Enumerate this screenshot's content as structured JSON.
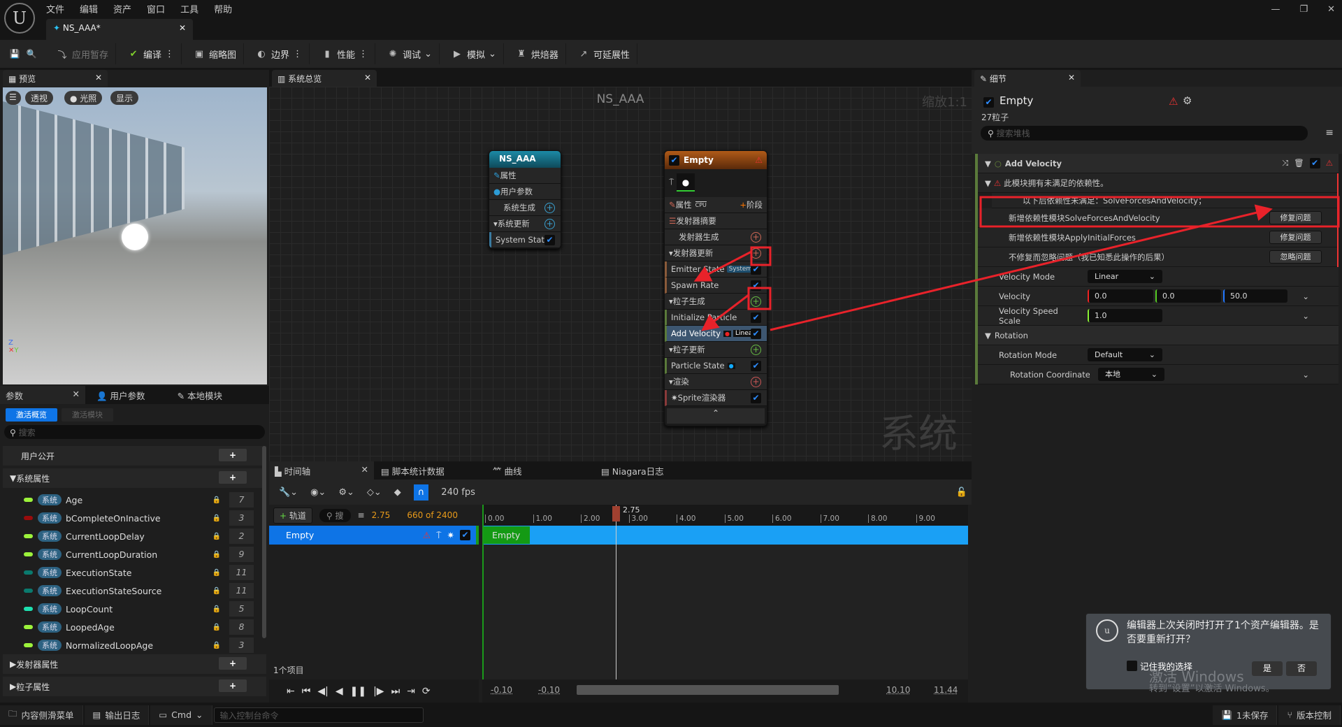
{
  "menu": [
    "文件",
    "编辑",
    "资产",
    "窗口",
    "工具",
    "帮助"
  ],
  "document_tab": "NS_AAA*",
  "toolbar": [
    "应用暂存",
    "编译",
    "缩略图",
    "边界",
    "性能",
    "调试",
    "模拟",
    "烘焙器",
    "可延展性"
  ],
  "preview": {
    "tab": "预览",
    "buttons": [
      "透视",
      "光照",
      "显示"
    ],
    "axes": [
      "Z",
      "Y"
    ]
  },
  "params": {
    "tabs": [
      "参数",
      "用户参数",
      "本地模块"
    ],
    "filter_tabs": [
      "激活概览",
      "激活模块"
    ],
    "search_placeholder": "搜索",
    "sections": {
      "user": "用户公开",
      "system": "系统属性",
      "emitter": "发射器属性",
      "particle": "粒子属性"
    },
    "badge": "系统",
    "items": [
      {
        "name": "Age",
        "count": "7",
        "color": "#9cf23b"
      },
      {
        "name": "bCompleteOnInactive",
        "count": "3",
        "color": "#9a0c0c"
      },
      {
        "name": "CurrentLoopDelay",
        "count": "2",
        "color": "#9cf23b"
      },
      {
        "name": "CurrentLoopDuration",
        "count": "9",
        "color": "#9cf23b"
      },
      {
        "name": "ExecutionState",
        "count": "11",
        "color": "#0a7a6e"
      },
      {
        "name": "ExecutionStateSource",
        "count": "11",
        "color": "#0a7a6e"
      },
      {
        "name": "LoopCount",
        "count": "5",
        "color": "#1ee0b0"
      },
      {
        "name": "LoopedAge",
        "count": "8",
        "color": "#9cf23b"
      },
      {
        "name": "NormalizedLoopAge",
        "count": "3",
        "color": "#9cf23b"
      }
    ]
  },
  "overview": {
    "tab": "系统总览",
    "title": "NS_AAA",
    "zoom": "缩放1:1",
    "watermark": "系统",
    "system_node": {
      "title": "NS_AAA",
      "rows": [
        "属性",
        "用户参数",
        "系统生成",
        "系统更新",
        "System State"
      ]
    },
    "emitter_node": {
      "title": "Empty",
      "props": "属性",
      "cpu": "CPU",
      "stage": "阶段",
      "summary": "发射器摘要",
      "emitter_spawn": "发射器生成",
      "emitter_update": "发射器更新",
      "emitter_state": "Emitter State",
      "system_tag": "System",
      "spawn_rate": "Spawn Rate",
      "particle_spawn": "粒子生成",
      "init_particle": "Initialize Particle",
      "add_velocity": "Add Velocity",
      "linear_tag": "Linear",
      "particle_update": "粒子更新",
      "particle_state": "Particle State",
      "render": "渲染",
      "sprite": "Sprite渲染器"
    }
  },
  "timeline": {
    "tabs": [
      "时间轴",
      "脚本统计数据",
      "曲线",
      "Niagara日志"
    ],
    "fps": "240 fps",
    "add_track": "轨道",
    "search": "搜",
    "time": "2.75",
    "frame": "660 of 2400",
    "track": "Empty",
    "playhead": "2.75",
    "ticks": [
      "0.00",
      "1.00",
      "2.00",
      "3.00",
      "4.00",
      "5.00",
      "6.00",
      "7.00",
      "8.00",
      "9.00"
    ],
    "count": "1个项目",
    "range": [
      "-0.10",
      "-0.10",
      "10.10",
      "11.44"
    ]
  },
  "details": {
    "tab": "细节",
    "emitter": "Empty",
    "particles": "27粒子",
    "search_placeholder": "搜索堆栈",
    "module": "Add Velocity",
    "warning": "此模块拥有未满足的依赖性。",
    "dep_missing": "以下后依赖性未满足：SolveForcesAndVelocity；",
    "fixes": [
      {
        "text": "新增依赖性模块SolveForcesAndVelocity",
        "button": "修复问题"
      },
      {
        "text": "新增依赖性模块ApplyInitialForces",
        "button": "修复问题"
      },
      {
        "text": "不修复而忽略问题（我已知悉此操作的后果）",
        "button": "忽略问题"
      }
    ],
    "velocity_mode": {
      "label": "Velocity Mode",
      "value": "Linear"
    },
    "velocity": {
      "label": "Velocity",
      "x": "0.0",
      "y": "0.0",
      "z": "50.0"
    },
    "speed_scale": {
      "label": "Velocity Speed Scale",
      "value": "1.0"
    },
    "rotation": "Rotation",
    "rotation_mode": {
      "label": "Rotation Mode",
      "value": "Default"
    },
    "rotation_coord": {
      "label": "Rotation Coordinate Space",
      "value": "本地"
    }
  },
  "notification": {
    "message": "编辑器上次关闭时打开了1个资产编辑器。是否要重新打开？",
    "remember": "记住我的选择",
    "yes": "是",
    "no": "否",
    "watermark1": "激活 Windows",
    "watermark2": "转到“设置”以激活 Windows。"
  },
  "statusbar": {
    "drawer": "内容侧滑菜单",
    "log": "输出日志",
    "cmd": "Cmd",
    "console_placeholder": "输入控制台命令",
    "unsaved": "1未保存",
    "source_control": "版本控制"
  },
  "colors": {
    "accent": "#0e74e6",
    "annotation": "#e8222a",
    "timeline_track": "#1aa0f5"
  }
}
